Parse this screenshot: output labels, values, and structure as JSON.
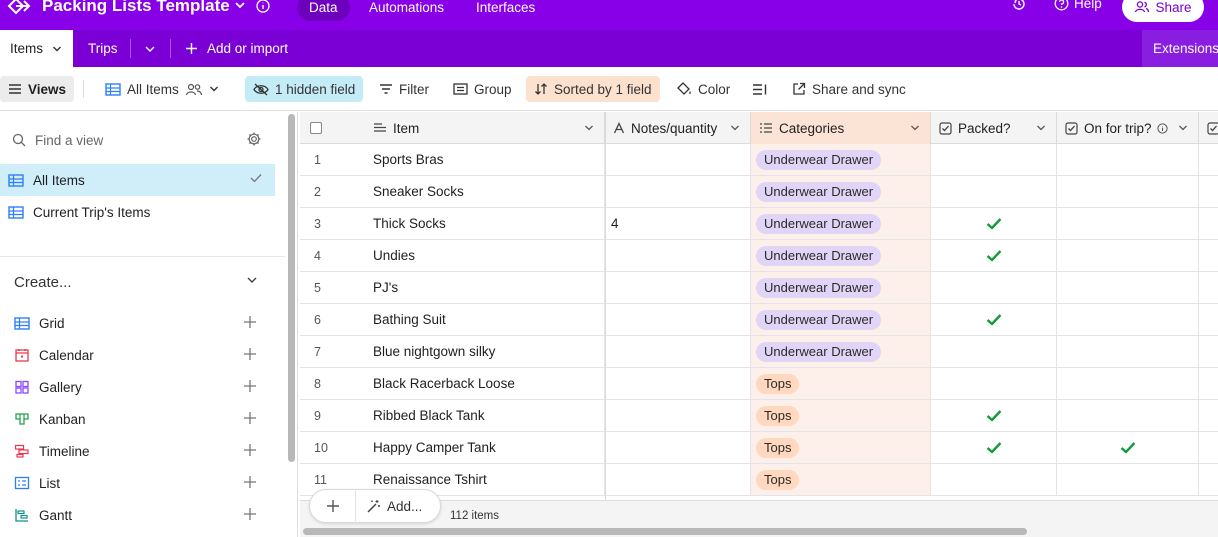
{
  "topbar": {
    "base_title": "Packing Lists Template",
    "tabs": [
      "Data",
      "Automations",
      "Interfaces"
    ],
    "active_tab": "Data",
    "help_label": "Help",
    "share_label": "Share"
  },
  "tables": {
    "active": "Items",
    "other": "Trips",
    "add_label": "Add or import",
    "extensions_label": "Extensions"
  },
  "viewbar": {
    "views_label": "Views",
    "current_view": "All Items",
    "hidden_label": "1 hidden field",
    "filter_label": "Filter",
    "group_label": "Group",
    "sorted_label": "Sorted by 1 field",
    "color_label": "Color",
    "share_sync_label": "Share and sync"
  },
  "sidebar": {
    "find_placeholder": "Find a view",
    "views": [
      {
        "label": "All Items",
        "active": true
      },
      {
        "label": "Current Trip's Items",
        "active": false
      }
    ],
    "create_heading": "Create...",
    "create_items": [
      {
        "label": "Grid",
        "icon": "grid-icon",
        "color": "#2d7ff9"
      },
      {
        "label": "Calendar",
        "icon": "calendar-icon",
        "color": "#e8384f"
      },
      {
        "label": "Gallery",
        "icon": "gallery-icon",
        "color": "#8b46ff"
      },
      {
        "label": "Kanban",
        "icon": "kanban-icon",
        "color": "#20a44a"
      },
      {
        "label": "Timeline",
        "icon": "timeline-icon",
        "color": "#e8384f"
      },
      {
        "label": "List",
        "icon": "list-icon",
        "color": "#2d7ff9"
      },
      {
        "label": "Gantt",
        "icon": "gantt-icon",
        "color": "#11928a"
      }
    ]
  },
  "grid": {
    "columns": [
      "Item",
      "Notes/quantity",
      "Categories",
      "Packed?",
      "On for trip?"
    ],
    "rows": [
      {
        "n": "1",
        "item": "Sports Bras",
        "notes": "",
        "category": "Underwear Drawer",
        "packed": false,
        "trip": false
      },
      {
        "n": "2",
        "item": "Sneaker Socks",
        "notes": "",
        "category": "Underwear Drawer",
        "packed": false,
        "trip": false
      },
      {
        "n": "3",
        "item": "Thick Socks",
        "notes": "4",
        "category": "Underwear Drawer",
        "packed": true,
        "trip": false
      },
      {
        "n": "4",
        "item": "Undies",
        "notes": "",
        "category": "Underwear Drawer",
        "packed": true,
        "trip": false
      },
      {
        "n": "5",
        "item": "PJ's",
        "notes": "",
        "category": "Underwear Drawer",
        "packed": false,
        "trip": false
      },
      {
        "n": "6",
        "item": "Bathing Suit",
        "notes": "",
        "category": "Underwear Drawer",
        "packed": true,
        "trip": false
      },
      {
        "n": "7",
        "item": "Blue nightgown silky",
        "notes": "",
        "category": "Underwear Drawer",
        "packed": false,
        "trip": false
      },
      {
        "n": "8",
        "item": "Black Racerback Loose",
        "notes": "",
        "category": "Tops",
        "packed": false,
        "trip": false
      },
      {
        "n": "9",
        "item": "Ribbed Black Tank",
        "notes": "",
        "category": "Tops",
        "packed": true,
        "trip": false
      },
      {
        "n": "10",
        "item": "Happy Camper Tank",
        "notes": "",
        "category": "Tops",
        "packed": true,
        "trip": true
      },
      {
        "n": "11",
        "item": "Renaissance Tshirt",
        "notes": "",
        "category": "Tops",
        "packed": false,
        "trip": false
      }
    ],
    "add_label": "Add...",
    "record_count": "112 items"
  },
  "colors": {
    "brand": "#8700e8",
    "check": "#109c3c",
    "category_underwear": "#e1d5f7",
    "category_tops": "#ffd8bf"
  }
}
